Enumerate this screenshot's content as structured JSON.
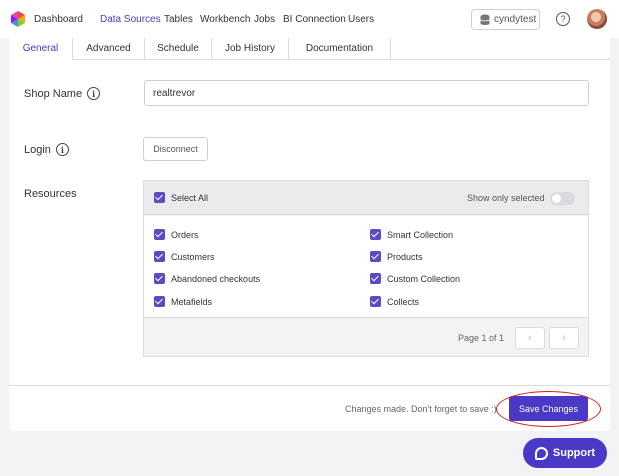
{
  "nav": {
    "items": [
      {
        "label": "Dashboard",
        "active": false
      },
      {
        "label": "Data Sources",
        "active": true
      },
      {
        "label": "Tables",
        "active": false
      },
      {
        "label": "Workbench",
        "active": false
      },
      {
        "label": "Jobs",
        "active": false
      },
      {
        "label": "BI Connection",
        "active": false
      },
      {
        "label": "Users",
        "active": false
      }
    ],
    "workspace": "cyndytest",
    "help_symbol": "?",
    "logo_icon": "logo-icon",
    "avatar_icon": "avatar"
  },
  "tabs": [
    {
      "label": "General",
      "active": true
    },
    {
      "label": "Advanced",
      "active": false
    },
    {
      "label": "Schedule",
      "active": false
    },
    {
      "label": "Job History",
      "active": false
    },
    {
      "label": "Documentation",
      "active": false
    }
  ],
  "form": {
    "shop_name": {
      "label": "Shop Name",
      "value": "realtrevor"
    },
    "login": {
      "label": "Login",
      "button": "Disconnect"
    },
    "resources": {
      "label": "Resources",
      "select_all": "Select All",
      "show_only_selected": "Show only selected",
      "show_only_selected_on": false,
      "left_items": [
        "Orders",
        "Customers",
        "Abandoned checkouts",
        "Metafields"
      ],
      "right_items": [
        "Smart Collection",
        "Products",
        "Custom Collection",
        "Collects"
      ],
      "page_info": "Page 1 of 1",
      "prev_symbol": "‹",
      "next_symbol": "›"
    },
    "info_symbol": "i"
  },
  "footer": {
    "message": "Changes made. Don't forget to save :)",
    "save_label": "Save Changes"
  },
  "support": {
    "label": "Support"
  },
  "colors": {
    "accent": "#4a39c6",
    "highlight_ring": "#d91b1b"
  }
}
